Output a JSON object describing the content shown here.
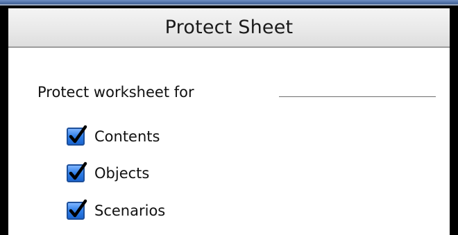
{
  "dialog": {
    "title": "Protect Sheet"
  },
  "protect_group": {
    "label": "Protect worksheet for",
    "options": [
      {
        "label": "Contents",
        "checked": true,
        "icon": "checkbox-checked-icon"
      },
      {
        "label": "Objects",
        "checked": true,
        "icon": "checkbox-checked-icon"
      },
      {
        "label": "Scenarios",
        "checked": true,
        "icon": "checkbox-checked-icon"
      }
    ]
  },
  "colors": {
    "checkbox_fill": "#2f7fe8",
    "checkbox_border": "#1d4f9a",
    "checkmark": "#000000",
    "titlebar": "#e9e9e9",
    "background": "#ffffff"
  }
}
